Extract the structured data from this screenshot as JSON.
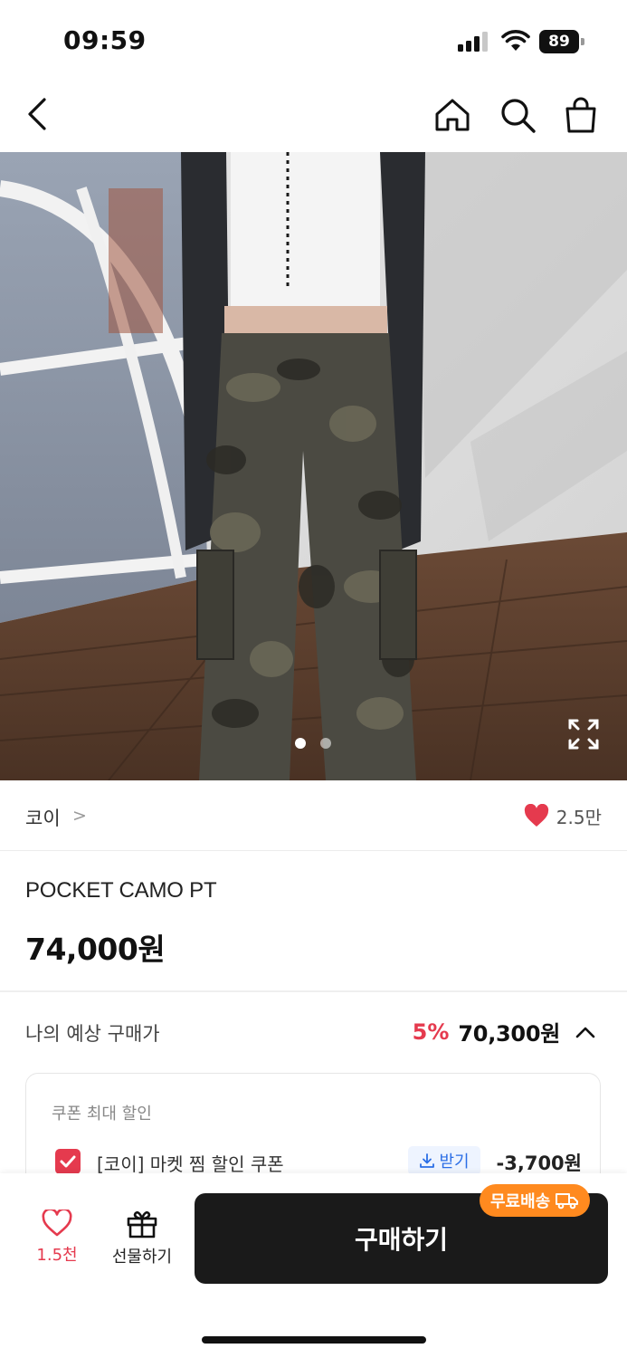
{
  "status": {
    "time": "09:59",
    "battery": "89"
  },
  "nav": {
    "back_icon": "chevron-left-icon",
    "home_icon": "home-icon",
    "search_icon": "search-icon",
    "bag_icon": "shopping-bag-icon"
  },
  "gallery": {
    "total_images": 2,
    "active_index": 0,
    "expand_icon": "expand-icon"
  },
  "brand": {
    "name": "코이",
    "chevron": ">",
    "likes": "2.5만"
  },
  "product": {
    "title": "POCKET CAMO PT",
    "price": "74,000원"
  },
  "estimate": {
    "label": "나의 예상 구매가",
    "discount": "5%",
    "price": "70,300원",
    "expanded": true
  },
  "coupon": {
    "title": "쿠폰 최대 할인",
    "items": [
      {
        "name": "[코이] 마켓 찜 할인 쿠폰",
        "get_label": "받기",
        "amount": "-3,700원",
        "checked": true
      }
    ]
  },
  "bottom": {
    "wish_count": "1.5천",
    "gift_label": "선물하기",
    "buy_label": "구매하기",
    "free_shipping": "무료배송"
  },
  "colors": {
    "accent_red": "#e53a4e",
    "buy_button": "#1a1a1a",
    "free_ship": "#ff8a1f",
    "coupon_blue": "#2b6ee6"
  }
}
